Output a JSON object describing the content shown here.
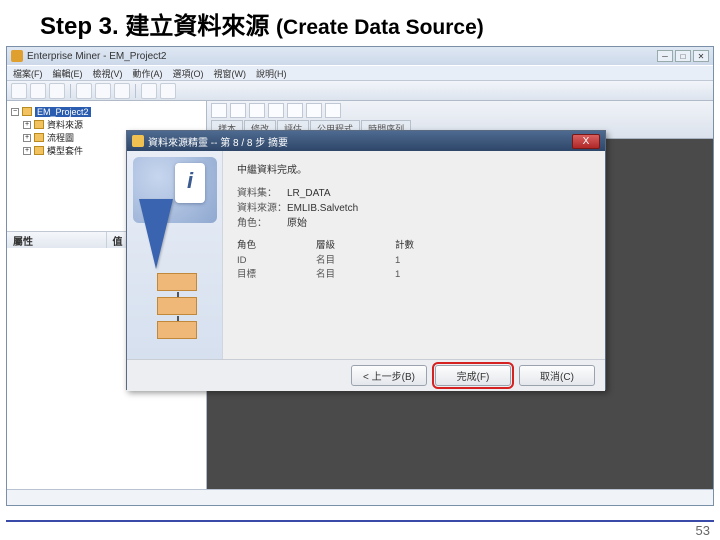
{
  "slide": {
    "step": "Step 3.",
    "title_zh": "建立資料來源",
    "title_en": "(Create Data Source)",
    "number": "53"
  },
  "app": {
    "title": "Enterprise Miner - EM_Project2",
    "menu": [
      "檔案(F)",
      "編輯(E)",
      "檢視(V)",
      "動作(A)",
      "選項(O)",
      "視窗(W)",
      "說明(H)"
    ]
  },
  "tree": {
    "root": "EM_Project2",
    "items": [
      "資料來源",
      "流程圖",
      "模型套件"
    ]
  },
  "props": {
    "col1": "屬性",
    "col2": "值"
  },
  "tabs": [
    "樣本",
    "修改",
    "評估",
    "公用程式",
    "時間序列"
  ],
  "wizard": {
    "title": "資料來源精靈 -- 第 8 / 8 步 摘要",
    "close": "X",
    "header": "中繼資料完成。",
    "meta": {
      "lbl_name": "資料集：",
      "name": "LR_DATA",
      "lbl_src": "資料來源：",
      "src": "EMLIB.Salvetch",
      "lbl_role": "角色：",
      "role": "原始"
    },
    "summary": {
      "c1h": "角色",
      "c1a": "ID",
      "c1b": "目標",
      "c2h": "層級",
      "c2a": "名目",
      "c2b": "名目",
      "c3h": "計數",
      "c3a": "1",
      "c3b": "1"
    },
    "btn_back": "< 上一步(B)",
    "btn_finish": "完成(F)",
    "btn_cancel": "取消(C)"
  }
}
